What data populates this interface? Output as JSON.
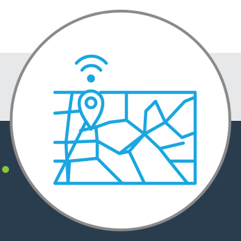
{
  "colors": {
    "icon_stroke": "#1aa6e0",
    "badge_border": "#8a8a8a",
    "background_dark": "#2a3d4f",
    "background_light": "#e7e8ea",
    "accent_dot": "#8ac63f"
  },
  "icon": {
    "name": "map-location-signal-icon"
  }
}
